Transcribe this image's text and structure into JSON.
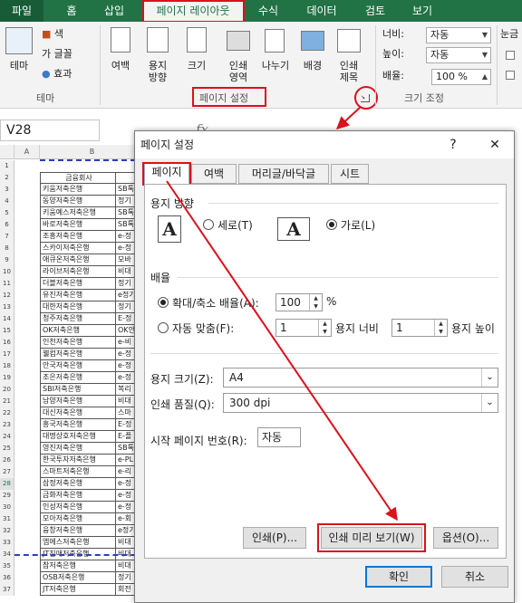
{
  "tabs": [
    "파일",
    "홈",
    "삽입",
    "페이지 레이아웃",
    "수식",
    "데이터",
    "검토",
    "보기"
  ],
  "ribbon": {
    "theme_label": "테마",
    "theme_colors": "색",
    "theme_fonts": "글꼴",
    "theme_effects": "효과",
    "theme_group": "테마",
    "margins": "여백",
    "orientation_l1": "용지",
    "orientation_l2": "방향",
    "size": "크기",
    "print_area_l1": "인쇄",
    "print_area_l2": "영역",
    "breaks": "나누기",
    "background": "배경",
    "print_titles_l1": "인쇄",
    "print_titles_l2": "제목",
    "page_setup_group": "페이지 설정",
    "width_label": "너비:",
    "width_value": "자동",
    "height_label": "높이:",
    "height_value": "자동",
    "scale_label": "배율:",
    "scale_value": "100 %",
    "scale_group": "크기 조정",
    "gridlines": "눈금"
  },
  "formula_bar": {
    "name_box": "V28",
    "fx": "fx"
  },
  "sheet": {
    "columns": [
      "A",
      "B"
    ],
    "header_cell": "금융회사",
    "rows": [
      {
        "n": "1",
        "b": "",
        "c": ""
      },
      {
        "n": "2",
        "b": "금융회사",
        "c": ""
      },
      {
        "n": "3",
        "b": "키움저축은행",
        "c": "SB톡"
      },
      {
        "n": "4",
        "b": "동양저축은행",
        "c": "정기"
      },
      {
        "n": "5",
        "b": "키움예스저축은행",
        "c": "SB톡"
      },
      {
        "n": "6",
        "b": "바로저축은행",
        "c": "SB톡"
      },
      {
        "n": "7",
        "b": "조흥저축은행",
        "c": "e-정"
      },
      {
        "n": "8",
        "b": "스카이저축은행",
        "c": "e-정"
      },
      {
        "n": "9",
        "b": "애큐온저축은행",
        "c": "모바"
      },
      {
        "n": "10",
        "b": "라이브저축은행",
        "c": "비대"
      },
      {
        "n": "11",
        "b": "더블저축은행",
        "c": "정기"
      },
      {
        "n": "12",
        "b": "유진저축은행",
        "c": "e정기"
      },
      {
        "n": "13",
        "b": "대한저축은행",
        "c": "정기"
      },
      {
        "n": "14",
        "b": "청주저축은행",
        "c": "E-정"
      },
      {
        "n": "15",
        "b": "OK저축은행",
        "c": "OK안"
      },
      {
        "n": "16",
        "b": "인천저축은행",
        "c": "e-비"
      },
      {
        "n": "17",
        "b": "웰컴저축은행",
        "c": "e-정"
      },
      {
        "n": "18",
        "b": "안국저축은행",
        "c": "e-정"
      },
      {
        "n": "19",
        "b": "조은저축은행",
        "c": "e-정"
      },
      {
        "n": "20",
        "b": "SBI저축은행",
        "c": "복리"
      },
      {
        "n": "21",
        "b": "남양저축은행",
        "c": "비대"
      },
      {
        "n": "22",
        "b": "대신저축은행",
        "c": "스마"
      },
      {
        "n": "23",
        "b": "흥국저축은행",
        "c": "E-정"
      },
      {
        "n": "24",
        "b": "대명상호저축은행",
        "c": "E-플"
      },
      {
        "n": "25",
        "b": "영진저축은행",
        "c": "SB톡"
      },
      {
        "n": "26",
        "b": "한국투자저축은행",
        "c": "e-PL"
      },
      {
        "n": "27",
        "b": "스마트저축은행",
        "c": "e-리"
      },
      {
        "n": "28",
        "b": "삼정저축은행",
        "c": "e-정"
      },
      {
        "n": "29",
        "b": "금화저축은행",
        "c": "e-정"
      },
      {
        "n": "30",
        "b": "인성저축은행",
        "c": "e-정"
      },
      {
        "n": "31",
        "b": "모아저축은행",
        "c": "e-회"
      },
      {
        "n": "32",
        "b": "융창저축은행",
        "c": "e정기"
      },
      {
        "n": "33",
        "b": "엠에스저축은행",
        "c": "비대"
      },
      {
        "n": "34",
        "b": "JT친애저축은행",
        "c": "비대"
      },
      {
        "n": "35",
        "b": "참저축은행",
        "c": "비대"
      },
      {
        "n": "36",
        "b": "OSB저축은행",
        "c": "정기"
      },
      {
        "n": "37",
        "b": "JT저축은행",
        "c": "회전"
      }
    ]
  },
  "dialog": {
    "title": "페이지 설정",
    "help": "?",
    "close": "✕",
    "tabs": [
      "페이지",
      "여백",
      "머리글/바닥글",
      "시트"
    ],
    "orientation_title": "용지 방향",
    "portrait": "세로(T)",
    "landscape": "가로(L)",
    "icon_letter": "A",
    "scaling_title": "배율",
    "adjust_to": "확대/축소 배율(A):",
    "adjust_value": "100",
    "percent": "%",
    "fit_to": "자동 맞춤(F):",
    "fit_wide_value": "1",
    "fit_wide_label": "용지 너비",
    "fit_tall_value": "1",
    "fit_tall_label": "용지 높이",
    "paper_size_label": "용지 크기(Z):",
    "paper_size_value": "A4",
    "print_quality_label": "인쇄 품질(Q):",
    "print_quality_value": "300 dpi",
    "first_page_label": "시작 페이지 번호(R):",
    "first_page_value": "자동",
    "print_btn": "인쇄(P)...",
    "preview_btn": "인쇄 미리 보기(W)",
    "options_btn": "옵션(O)...",
    "ok_btn": "확인",
    "cancel_btn": "취소"
  },
  "colors": {
    "excel_green": "#217346",
    "annotation_red": "#d9121c",
    "focus_blue": "#0078d7"
  }
}
